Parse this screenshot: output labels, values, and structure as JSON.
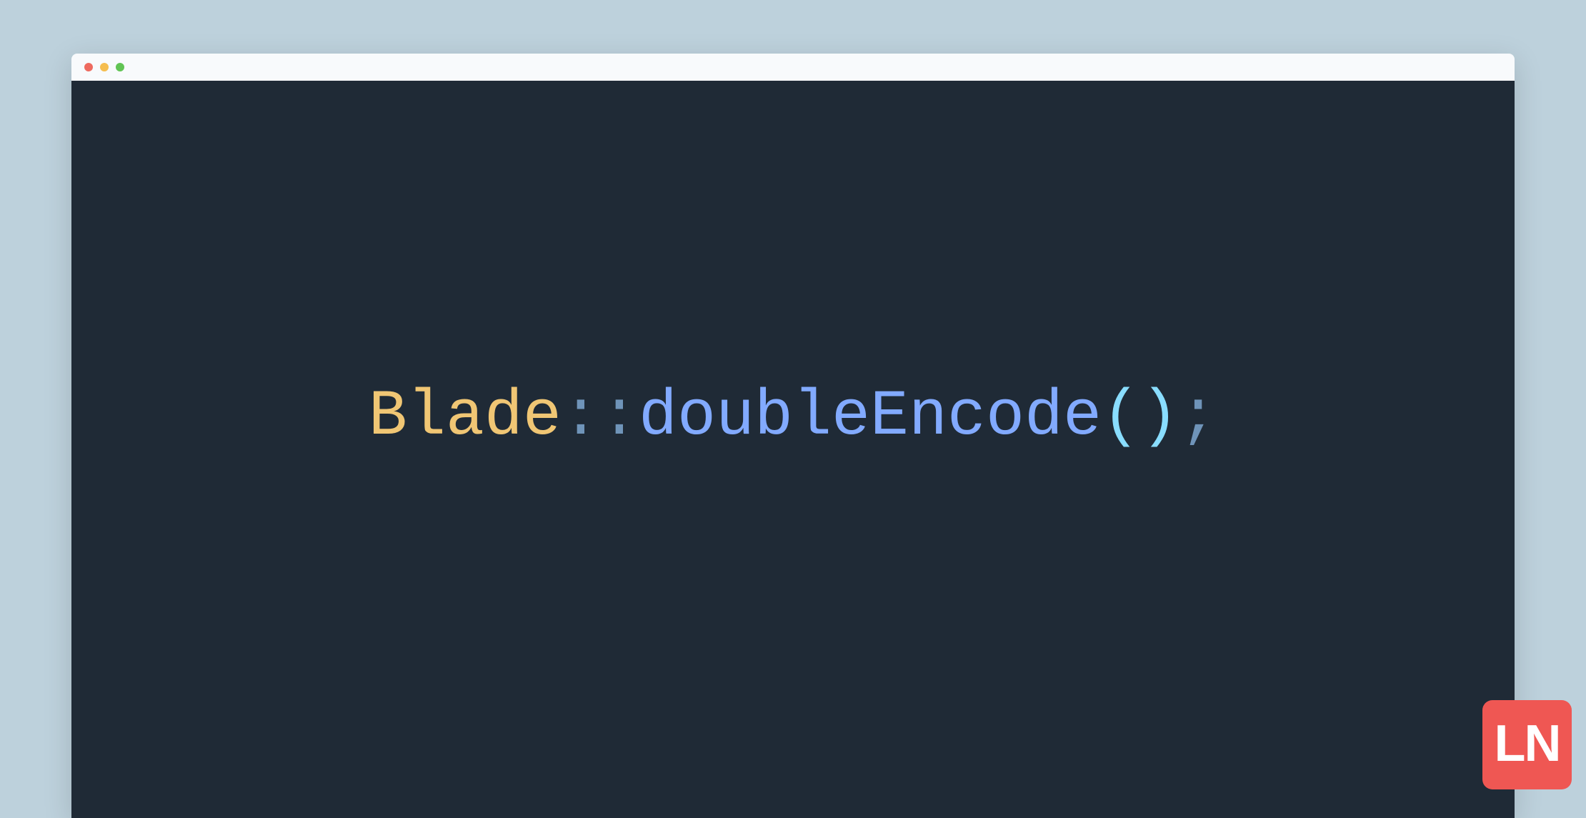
{
  "window": {
    "traffic_lights": {
      "red": "#ee6a5f",
      "yellow": "#f5bd4f",
      "green": "#61c454"
    }
  },
  "code": {
    "class_name": "Blade",
    "scope_operator": "::",
    "method_name": "doubleEncode",
    "parens": "()",
    "semicolon": ";"
  },
  "colors": {
    "page_bg": "#bdd1dc",
    "titlebar_bg": "#f8fafc",
    "editor_bg": "#1f2a36",
    "token_class": "#f0c674",
    "token_scope": "#6f94b9",
    "token_method": "#82aaff",
    "token_paren": "#89ddff",
    "token_semi": "#6f94b9",
    "logo_bg": "#ef5753",
    "logo_fg": "#ffffff"
  },
  "logo": {
    "text": "LN"
  }
}
